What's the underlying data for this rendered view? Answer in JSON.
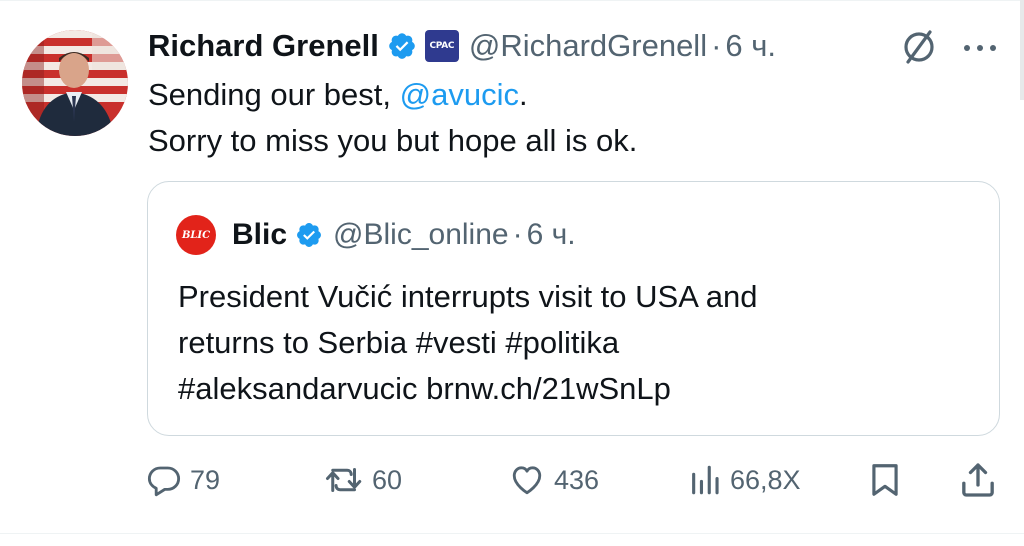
{
  "tweet": {
    "author_name": "Richard Grenell",
    "handle": "@RichardGrenell",
    "separator": "·",
    "time": "6 ч.",
    "affiliation_badge": "CPAC",
    "text_line1_prefix": "Sending our best, ",
    "mention": "@avucic",
    "text_line1_suffix": ".",
    "text_line2": "Sorry to miss you but hope all is ok."
  },
  "quote": {
    "avatar_text": "BLIC",
    "author_name": "Blic",
    "handle": "@Blic_online",
    "separator": "·",
    "time": "6 ч.",
    "text_line1": "President Vučić interrupts visit to USA and",
    "text_line2": "returns to Serbia #vesti #politika",
    "text_line3": "#aleksandarvucic brnw.ch/21wSnLp"
  },
  "actions": {
    "replies": "79",
    "reposts": "60",
    "likes": "436",
    "views": "66,8X"
  },
  "icons": {
    "verified": "verified-badge-icon",
    "grok": "grok-icon",
    "more": "more-options-icon",
    "reply": "reply-icon",
    "repost": "repost-icon",
    "like": "heart-icon",
    "views": "views-icon",
    "bookmark": "bookmark-icon",
    "share": "share-icon"
  },
  "colors": {
    "text": "#0f1419",
    "secondary": "#536471",
    "accent": "#1d9bf0",
    "border": "#cfd9de",
    "blic_red": "#e2231a"
  }
}
